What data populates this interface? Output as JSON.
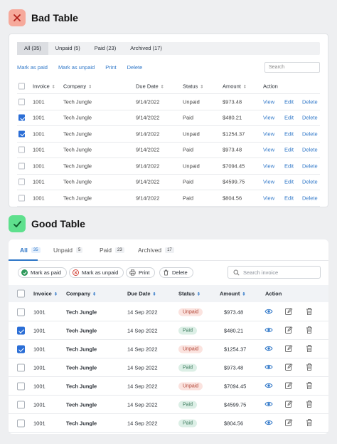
{
  "bad": {
    "title": "Bad Table",
    "icon": "close-icon",
    "tabs": [
      "All (35)",
      "Unpaid (5)",
      "Paid (23)",
      "Archived (17)"
    ],
    "actions": [
      "Mark as paid",
      "Mark as unpaid",
      "Print",
      "Delete"
    ],
    "search_placeholder": "Search",
    "columns": [
      "Invoice",
      "Company",
      "Due Date",
      "Status",
      "Amount",
      "Action"
    ],
    "action_links": [
      "View",
      "Edit",
      "Delete"
    ],
    "rows": [
      {
        "invoice": "1001",
        "company": "Tech Jungle",
        "date": "9/14/2022",
        "status": "Unpaid",
        "amount": "$973.48",
        "checked": false
      },
      {
        "invoice": "1001",
        "company": "Tech Jungle",
        "date": "9/14/2022",
        "status": "Paid",
        "amount": "$480.21",
        "checked": true
      },
      {
        "invoice": "1001",
        "company": "Tech Jungle",
        "date": "9/14/2022",
        "status": "Unpaid",
        "amount": "$1254.37",
        "checked": true
      },
      {
        "invoice": "1001",
        "company": "Tech Jungle",
        "date": "9/14/2022",
        "status": "Paid",
        "amount": "$973.48",
        "checked": false
      },
      {
        "invoice": "1001",
        "company": "Tech Jungle",
        "date": "9/14/2022",
        "status": "Unpaid",
        "amount": "$7094.45",
        "checked": false
      },
      {
        "invoice": "1001",
        "company": "Tech Jungle",
        "date": "9/14/2022",
        "status": "Paid",
        "amount": "$4599.75",
        "checked": false
      },
      {
        "invoice": "1001",
        "company": "Tech Jungle",
        "date": "9/14/2022",
        "status": "Paid",
        "amount": "$804.56",
        "checked": false
      }
    ]
  },
  "good": {
    "title": "Good Table",
    "icon": "check-icon",
    "tabs": [
      {
        "label": "All",
        "count": "35"
      },
      {
        "label": "Unpaid",
        "count": "5"
      },
      {
        "label": "Paid",
        "count": "23"
      },
      {
        "label": "Archived",
        "count": "17"
      }
    ],
    "actions": [
      "Mark as paid",
      "Mark as unpaid",
      "Print",
      "Delete"
    ],
    "search_placeholder": "Search invoice",
    "columns": [
      "Invoice",
      "Company",
      "Due Date",
      "Status",
      "Amount",
      "Action"
    ],
    "rows": [
      {
        "invoice": "1001",
        "company": "Tech Jungle",
        "date": "14 Sep 2022",
        "status": "Unpaid",
        "amount": "$973.48",
        "checked": false
      },
      {
        "invoice": "1001",
        "company": "Tech Jungle",
        "date": "14 Sep 2022",
        "status": "Paid",
        "amount": "$480.21",
        "checked": true
      },
      {
        "invoice": "1001",
        "company": "Tech Jungle",
        "date": "14 Sep 2022",
        "status": "Unpaid",
        "amount": "$1254.37",
        "checked": true
      },
      {
        "invoice": "1001",
        "company": "Tech Jungle",
        "date": "14 Sep 2022",
        "status": "Paid",
        "amount": "$973.48",
        "checked": false
      },
      {
        "invoice": "1001",
        "company": "Tech Jungle",
        "date": "14 Sep 2022",
        "status": "Unpaid",
        "amount": "$7094.45",
        "checked": false
      },
      {
        "invoice": "1001",
        "company": "Tech Jungle",
        "date": "14 Sep 2022",
        "status": "Paid",
        "amount": "$4599.75",
        "checked": false
      },
      {
        "invoice": "1001",
        "company": "Tech Jungle",
        "date": "14 Sep 2022",
        "status": "Paid",
        "amount": "$804.56",
        "checked": false
      }
    ]
  },
  "colors": {
    "accent": "#2f77c8",
    "bad_badge": "#f6a99b",
    "good_badge": "#5ee08d"
  }
}
